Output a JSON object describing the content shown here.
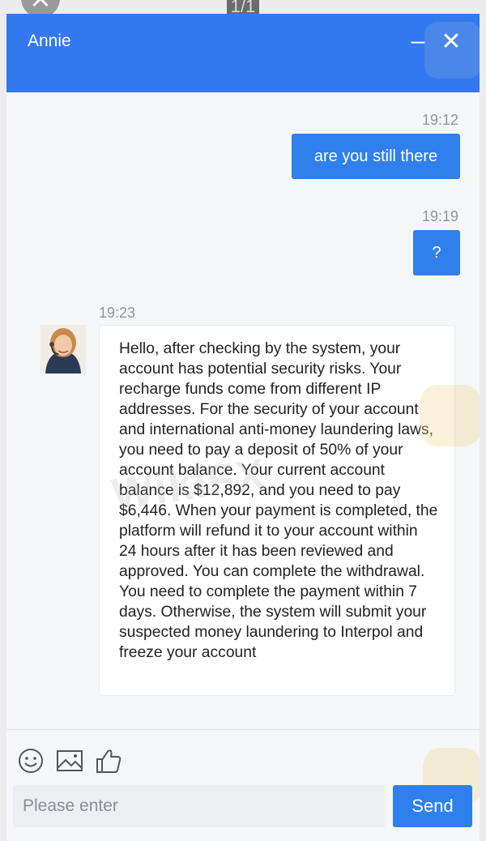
{
  "viewer": {
    "page_counter": "1/1",
    "close_icon": "close-icon"
  },
  "header": {
    "agent_name": "Annie",
    "minimize_label": "–",
    "close_label": "✕"
  },
  "messages": [
    {
      "direction": "outgoing",
      "time": "19:12",
      "text": "are you still there"
    },
    {
      "direction": "outgoing",
      "time": "19:19",
      "text": "?"
    },
    {
      "direction": "incoming",
      "time": "19:23",
      "text": "Hello, after checking by the system, your account has potential security risks. Your recharge funds come from different IP addresses. For the security of your account and international anti-money laundering laws, you need to pay a deposit of 50% of your account balance. Your current account balance is $12,892, and you need to pay $6,446. When your payment is completed, the platform will refund it to your account within 24 hours after it has been reviewed and approved. You can complete the withdrawal. You need to complete the payment within 7 days. Otherwise, the system will submit your suspected money laundering to Interpol and freeze your account"
    }
  ],
  "toolbar": {
    "icons": [
      "emoji-icon",
      "image-icon",
      "thumbs-up-icon"
    ]
  },
  "composer": {
    "placeholder": "Please enter",
    "send_label": "Send"
  },
  "watermark": {
    "text": "WikiFX"
  },
  "colors": {
    "header": "#3379f0",
    "outgoing_bubble": "#2f80ed",
    "send_button": "#2f80ed"
  }
}
